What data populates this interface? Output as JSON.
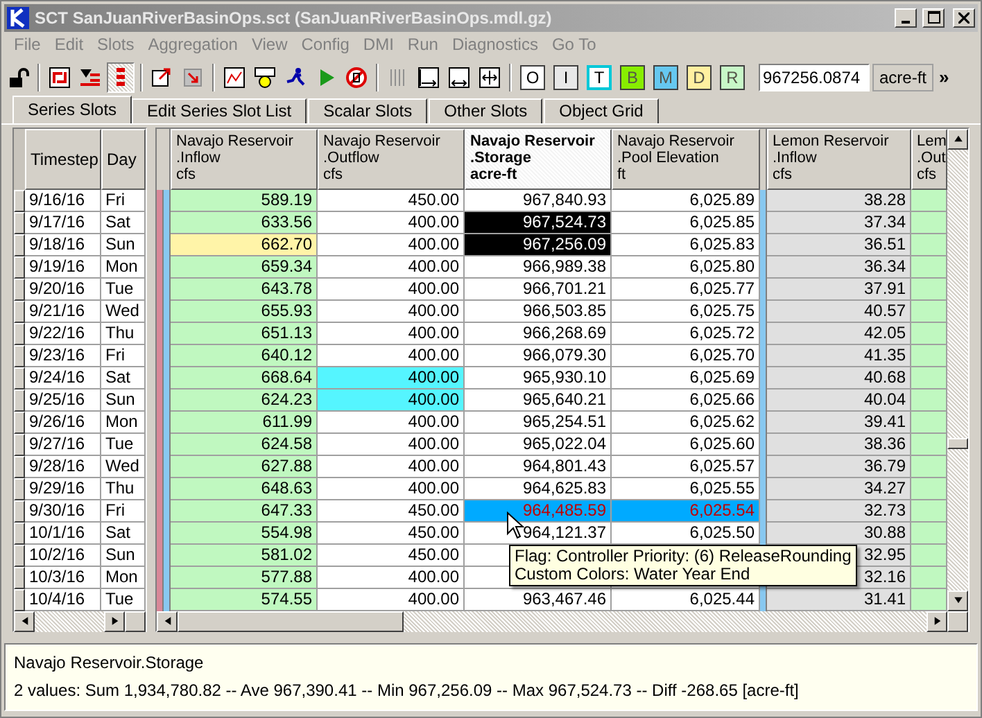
{
  "window": {
    "title": "SCT SanJuanRiverBasinOps.sct (SanJuanRiverBasinOps.mdl.gz)"
  },
  "menu": [
    "File",
    "Edit",
    "Slots",
    "Aggregation",
    "View",
    "Config",
    "DMI",
    "Run",
    "Diagnostics",
    "Go To"
  ],
  "toolbar": {
    "icons": [
      {
        "kind": "lock",
        "pressed": false
      },
      {
        "kind": "sep"
      },
      {
        "kind": "swap",
        "pressed": false
      },
      {
        "kind": "filter",
        "pressed": false
      },
      {
        "kind": "bars",
        "pressed": true
      },
      {
        "kind": "sep"
      },
      {
        "kind": "export",
        "pressed": false
      },
      {
        "kind": "import",
        "pressed": false
      },
      {
        "kind": "sep"
      },
      {
        "kind": "plot",
        "pressed": false
      },
      {
        "kind": "gauge",
        "pressed": false
      },
      {
        "kind": "runner",
        "pressed": false
      },
      {
        "kind": "play",
        "pressed": false
      },
      {
        "kind": "stop",
        "pressed": false
      },
      {
        "kind": "sep"
      },
      {
        "kind": "columns",
        "pressed": false
      },
      {
        "kind": "width-left",
        "pressed": false
      },
      {
        "kind": "width-both",
        "pressed": false
      },
      {
        "kind": "fit",
        "pressed": false
      },
      {
        "kind": "sep"
      }
    ],
    "letters": [
      {
        "label": "O",
        "color": "#ffffff",
        "outlined": false,
        "disabled": false
      },
      {
        "label": "I",
        "color": "#e8e8e8",
        "outlined": false,
        "disabled": false
      },
      {
        "label": "T",
        "color": "#ffffff",
        "outlined": true,
        "disabled": false
      },
      {
        "label": "B",
        "color": "#88ee00",
        "outlined": false,
        "disabled": true
      },
      {
        "label": "M",
        "color": "#66c8f0",
        "outlined": false,
        "disabled": true
      },
      {
        "label": "D",
        "color": "#fff0a0",
        "outlined": false,
        "disabled": true
      },
      {
        "label": "R",
        "color": "#c8f8c8",
        "outlined": false,
        "disabled": true
      }
    ],
    "value": "967256.0874",
    "unit": "acre-ft",
    "more": "»"
  },
  "tabs": [
    {
      "label": "Series Slots",
      "selected": true
    },
    {
      "label": "Edit Series Slot List",
      "selected": false
    },
    {
      "label": "Scalar Slots",
      "selected": false
    },
    {
      "label": "Other Slots",
      "selected": false
    },
    {
      "label": "Object Grid",
      "selected": false
    }
  ],
  "table": {
    "fixed_columns": [
      "Timestep",
      "Day"
    ],
    "columns": [
      {
        "object": "Navajo Reservoir",
        "slot": ".Inflow",
        "unit": "cfs",
        "selected": false,
        "color": "#c0f8c0"
      },
      {
        "object": "Navajo Reservoir",
        "slot": ".Outflow",
        "unit": "cfs",
        "selected": false,
        "color": "#ffffff"
      },
      {
        "object": "Navajo Reservoir",
        "slot": ".Storage",
        "unit": "acre-ft",
        "selected": true,
        "color": "#ffffff"
      },
      {
        "object": "Navajo Reservoir",
        "slot": ".Pool Elevation",
        "unit": "ft",
        "selected": false,
        "color": "#ffffff"
      },
      {
        "object": "Lemon Reservoir",
        "slot": ".Inflow",
        "unit": "cfs",
        "selected": false,
        "color": "#e0e0e0"
      },
      {
        "object": "Lem",
        "slot": ".Out",
        "unit": "cfs",
        "selected": false,
        "color": "#c0f8c0"
      }
    ],
    "rows": [
      {
        "timestep": "9/16/16",
        "day": "Fri",
        "cells": [
          {
            "value": "589.19"
          },
          {
            "value": "450.00"
          },
          {
            "value": "967,840.93"
          },
          {
            "value": "6,025.89"
          },
          {
            "value": "38.28"
          },
          {}
        ]
      },
      {
        "timestep": "9/17/16",
        "day": "Sat",
        "cells": [
          {
            "value": "633.56"
          },
          {
            "value": "400.00"
          },
          {
            "value": "967,524.73",
            "color": "#000000"
          },
          {
            "value": "6,025.85"
          },
          {
            "value": "37.34"
          },
          {}
        ]
      },
      {
        "timestep": "9/18/16",
        "day": "Sun",
        "cells": [
          {
            "value": "662.70",
            "color": "#fff4a8"
          },
          {
            "value": "400.00"
          },
          {
            "value": "967,256.09",
            "color": "#000000"
          },
          {
            "value": "6,025.83"
          },
          {
            "value": "36.51"
          },
          {}
        ]
      },
      {
        "timestep": "9/19/16",
        "day": "Mon",
        "cells": [
          {
            "value": "659.34"
          },
          {
            "value": "400.00"
          },
          {
            "value": "966,989.38"
          },
          {
            "value": "6,025.80"
          },
          {
            "value": "36.34"
          },
          {}
        ]
      },
      {
        "timestep": "9/20/16",
        "day": "Tue",
        "cells": [
          {
            "value": "643.78"
          },
          {
            "value": "400.00"
          },
          {
            "value": "966,701.21"
          },
          {
            "value": "6,025.77"
          },
          {
            "value": "37.91"
          },
          {}
        ]
      },
      {
        "timestep": "9/21/16",
        "day": "Wed",
        "cells": [
          {
            "value": "655.93"
          },
          {
            "value": "400.00"
          },
          {
            "value": "966,503.85"
          },
          {
            "value": "6,025.75"
          },
          {
            "value": "40.57"
          },
          {}
        ]
      },
      {
        "timestep": "9/22/16",
        "day": "Thu",
        "cells": [
          {
            "value": "651.13"
          },
          {
            "value": "400.00"
          },
          {
            "value": "966,268.69"
          },
          {
            "value": "6,025.72"
          },
          {
            "value": "42.05"
          },
          {}
        ]
      },
      {
        "timestep": "9/23/16",
        "day": "Fri",
        "cells": [
          {
            "value": "640.12"
          },
          {
            "value": "400.00"
          },
          {
            "value": "966,079.30"
          },
          {
            "value": "6,025.70"
          },
          {
            "value": "41.35"
          },
          {}
        ]
      },
      {
        "timestep": "9/24/16",
        "day": "Sat",
        "cells": [
          {
            "value": "668.64"
          },
          {
            "value": "400.00",
            "color": "#55f5ff"
          },
          {
            "value": "965,930.10"
          },
          {
            "value": "6,025.69"
          },
          {
            "value": "40.68"
          },
          {}
        ]
      },
      {
        "timestep": "9/25/16",
        "day": "Sun",
        "cells": [
          {
            "value": "624.23"
          },
          {
            "value": "400.00",
            "color": "#55f5ff"
          },
          {
            "value": "965,640.21"
          },
          {
            "value": "6,025.66"
          },
          {
            "value": "40.04"
          },
          {}
        ]
      },
      {
        "timestep": "9/26/16",
        "day": "Mon",
        "cells": [
          {
            "value": "611.99"
          },
          {
            "value": "400.00"
          },
          {
            "value": "965,254.51"
          },
          {
            "value": "6,025.62"
          },
          {
            "value": "39.41"
          },
          {}
        ]
      },
      {
        "timestep": "9/27/16",
        "day": "Tue",
        "cells": [
          {
            "value": "624.58"
          },
          {
            "value": "400.00"
          },
          {
            "value": "965,022.04"
          },
          {
            "value": "6,025.60"
          },
          {
            "value": "38.36"
          },
          {}
        ]
      },
      {
        "timestep": "9/28/16",
        "day": "Wed",
        "cells": [
          {
            "value": "627.88"
          },
          {
            "value": "400.00"
          },
          {
            "value": "964,801.43"
          },
          {
            "value": "6,025.57"
          },
          {
            "value": "36.79"
          },
          {}
        ]
      },
      {
        "timestep": "9/29/16",
        "day": "Thu",
        "cells": [
          {
            "value": "648.63"
          },
          {
            "value": "400.00"
          },
          {
            "value": "964,625.83"
          },
          {
            "value": "6,025.55"
          },
          {
            "value": "34.27"
          },
          {}
        ]
      },
      {
        "timestep": "9/30/16",
        "day": "Fri",
        "cells": [
          {
            "value": "647.33"
          },
          {
            "value": "450.00"
          },
          {
            "value": "964,485.59",
            "color": "#00aaff",
            "flagged": true
          },
          {
            "value": "6,025.54",
            "color": "#00aaff",
            "flagged": true
          },
          {
            "value": "32.73"
          },
          {}
        ]
      },
      {
        "timestep": "10/1/16",
        "day": "Sat",
        "cells": [
          {
            "value": "554.98"
          },
          {
            "value": "450.00"
          },
          {
            "value": "964,121.37"
          },
          {
            "value": "6,025.50"
          },
          {
            "value": "30.88"
          },
          {}
        ]
      },
      {
        "timestep": "10/2/16",
        "day": "Sun",
        "cells": [
          {
            "value": "581.02"
          },
          {
            "value": "450.00"
          },
          {},
          {},
          {
            "value": "32.95"
          },
          {}
        ]
      },
      {
        "timestep": "10/3/16",
        "day": "Mon",
        "cells": [
          {
            "value": "577.88"
          },
          {
            "value": "400.00"
          },
          {},
          {},
          {
            "value": "32.16"
          },
          {}
        ]
      },
      {
        "timestep": "10/4/16",
        "day": "Tue",
        "cells": [
          {
            "value": "574.55"
          },
          {
            "value": "400.00"
          },
          {
            "value": "963,467.46"
          },
          {
            "value": "6,025.44"
          },
          {
            "value": "31.41"
          },
          {}
        ]
      }
    ]
  },
  "tooltip": {
    "lines": [
      "Flag: Controller Priority: (6) ReleaseRounding",
      "Custom Colors: Water Year End"
    ]
  },
  "status": {
    "title": "Navajo Reservoir.Storage",
    "summary": "2 values:  Sum 1,934,780.82 -- Ave 967,390.41 -- Min 967,256.09 -- Max 967,524.73 -- Diff -268.65 [acre-ft]"
  }
}
